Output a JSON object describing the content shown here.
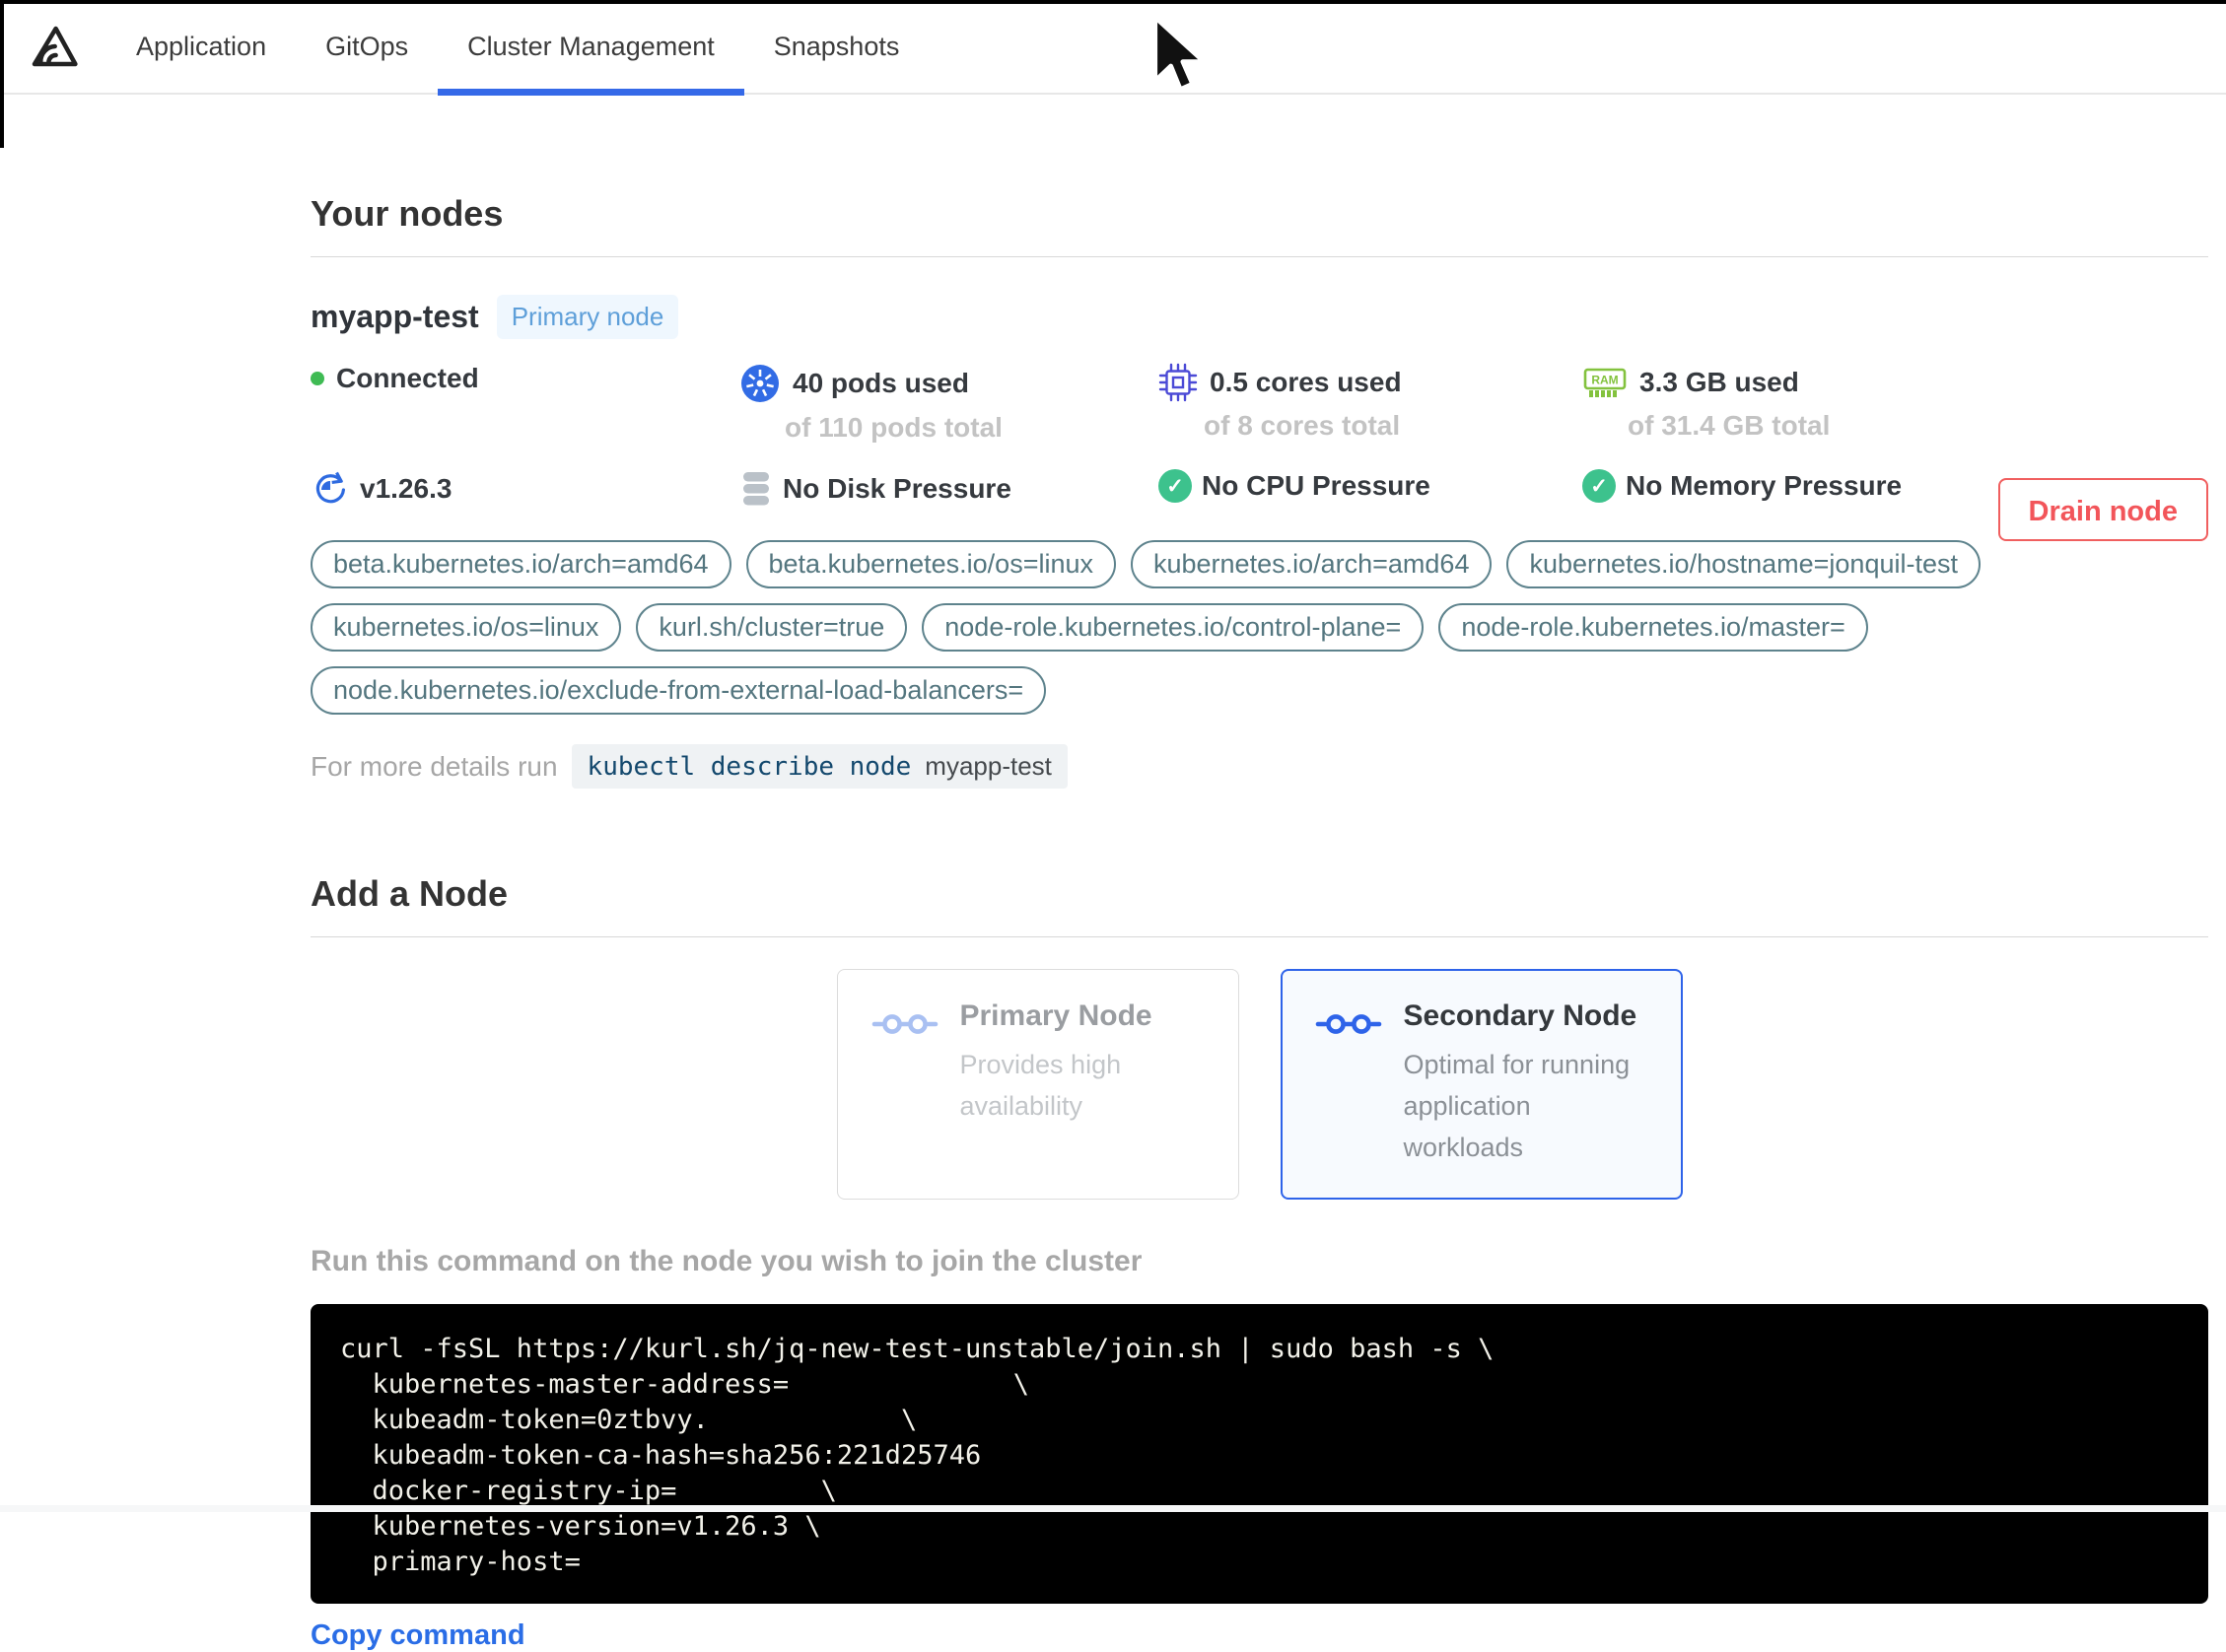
{
  "navbar": {
    "logo": "replicated-logo",
    "tabs": [
      {
        "label": "Application",
        "active": false
      },
      {
        "label": "GitOps",
        "active": false
      },
      {
        "label": "Cluster Management",
        "active": true
      },
      {
        "label": "Snapshots",
        "active": false
      }
    ]
  },
  "colors": {
    "accent_blue": "#3569e8",
    "badge_blue": "#5e9fd9",
    "pill_teal": "#54767f",
    "drain_red": "#f2555a",
    "ok_green": "#3dc28d",
    "kubernetes_blue": "#326ce5",
    "cpu_indigo": "#4b4ad6",
    "ram_green": "#83c23e"
  },
  "your_nodes": {
    "heading": "Your nodes",
    "node": {
      "name": "myapp-test",
      "badge": "Primary node",
      "status": "Connected",
      "details_prefix": "For more details run",
      "details_command": "kubectl describe node"
    },
    "stats_row1": [
      {
        "icon": "status-dot",
        "main": "Connected",
        "sub": ""
      },
      {
        "icon": "kubernetes",
        "main": "40 pods used",
        "sub": "of 110 pods total"
      },
      {
        "icon": "cpu",
        "main": "0.5 cores used",
        "sub": "of 8 cores total"
      },
      {
        "icon": "ram",
        "main": "3.3 GB used",
        "sub": "of 31.4 GB total"
      }
    ],
    "stats_row2": [
      {
        "icon": "version",
        "main": "v1.26.3"
      },
      {
        "icon": "disk",
        "main": "No Disk Pressure"
      },
      {
        "icon": "check",
        "main": "No CPU Pressure"
      },
      {
        "icon": "check",
        "main": "No Memory Pressure"
      }
    ],
    "labels": [
      "beta.kubernetes.io/arch=amd64",
      "beta.kubernetes.io/os=linux",
      "kubernetes.io/arch=amd64",
      "kubernetes.io/hostname=jonquil-test",
      "kubernetes.io/os=linux",
      "kurl.sh/cluster=true",
      "node-role.kubernetes.io/control-plane=",
      "node-role.kubernetes.io/master=",
      "node.kubernetes.io/exclude-from-external-load-balancers="
    ],
    "drain_button_label": "Drain node"
  },
  "add_node": {
    "heading": "Add a Node",
    "cards": [
      {
        "title": "Primary Node",
        "description": "Provides high availability",
        "selected": false
      },
      {
        "title": "Secondary Node",
        "description": "Optimal for running application workloads",
        "selected": true
      }
    ],
    "instruction": "Run this command on the node you wish to join the cluster",
    "terminal_lines": [
      "curl -fsSL https://kurl.sh/jq-new-test-unstable/join.sh | sudo bash -s \\",
      "  kubernetes-master-address=              \\",
      "  kubeadm-token=0ztbvy.            \\",
      "  kubeadm-token-ca-hash=sha256:221d25746",
      "  docker-registry-ip=         \\",
      "  kubernetes-version=v1.26.3 \\",
      "  primary-host="
    ],
    "copy_label": "Copy command"
  }
}
